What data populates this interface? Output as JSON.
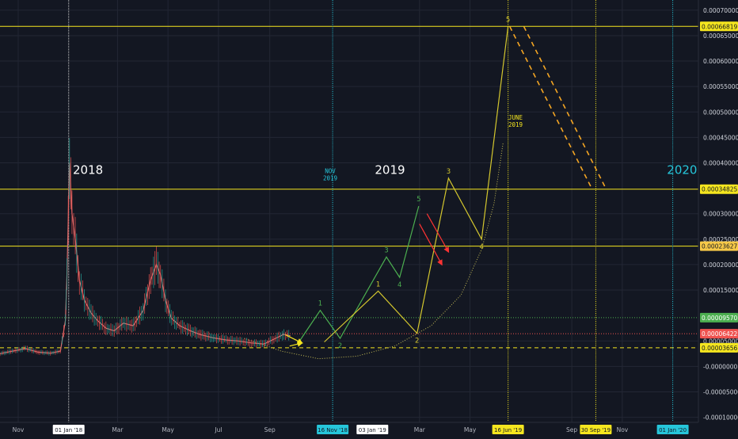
{
  "chart_data": {
    "type": "line",
    "x_range": [
      "2017-10-10",
      "2020-02-01"
    ],
    "y_range": [
      -0.00011,
      0.00072
    ],
    "price_ticks": [
      "0.00070000",
      "0.00065000",
      "0.00060000",
      "0.00055000",
      "0.00050000",
      "0.00045000",
      "0.00040000",
      "0.00030000",
      "0.00025000",
      "0.00020000",
      "0.00015000",
      "0.00005000",
      "-0.0000000",
      "-0.00005000",
      "-0.00010000"
    ],
    "time_ticks": [
      {
        "label": "Nov",
        "date": "2017-11-01"
      },
      {
        "label": "Mar",
        "date": "2018-03-01"
      },
      {
        "label": "May",
        "date": "2018-05-01"
      },
      {
        "label": "Jul",
        "date": "2018-07-01"
      },
      {
        "label": "Sep",
        "date": "2018-09-01"
      },
      {
        "label": "Mar",
        "date": "2019-03-01"
      },
      {
        "label": "May",
        "date": "2019-05-01"
      },
      {
        "label": "Sep",
        "date": "2019-09-01"
      },
      {
        "label": "Nov",
        "date": "2019-11-01"
      }
    ],
    "date_badges": [
      {
        "label": "01 Jan '18",
        "date": "2018-01-01",
        "color": "#ffffff",
        "line_color": "#cccccc"
      },
      {
        "label": "16 Nov '18",
        "date": "2018-11-16",
        "color": "#26c6da",
        "line_color": "#26c6da"
      },
      {
        "label": "03 Jan '19",
        "date": "2019-01-03",
        "color": "#ffffff",
        "line_color": null
      },
      {
        "label": "16 Jun '19",
        "date": "2019-06-16",
        "color": "#f5e61f",
        "line_color": "#f5e61f"
      },
      {
        "label": "30 Sep '19",
        "date": "2019-09-30",
        "color": "#f5e61f",
        "line_color": "#f5e61f"
      },
      {
        "label": "01 Jan '20",
        "date": "2020-01-01",
        "color": "#26c6da",
        "line_color": "#26c6da"
      }
    ],
    "price_levels": [
      {
        "label": "0.00066819",
        "value": 0.00066819,
        "color": "#f5e61f",
        "style": "solid"
      },
      {
        "label": "0.00034825",
        "value": 0.00034825,
        "color": "#f5e61f",
        "style": "solid"
      },
      {
        "label": "0.00023627",
        "value": 0.00023627,
        "color": "#f5e61f",
        "style": "solid",
        "badge_color": "#f7c948"
      },
      {
        "label": "0.00009570",
        "value": 9.57e-05,
        "color": "#4caf50",
        "style": "dotted",
        "badge_color": "#4caf50"
      },
      {
        "label": "0.00006422",
        "value": 6.422e-05,
        "color": "#ef5350",
        "style": "dotted",
        "badge_color": "#ef5350"
      },
      {
        "label": "0.00003656",
        "value": 3.656e-05,
        "color": "#f5e61f",
        "style": "dashed"
      }
    ],
    "year_labels": [
      {
        "text": "2018",
        "date": "2018-01-06",
        "value": 0.000378,
        "color": "#ffffff"
      },
      {
        "text": "2019",
        "date": "2019-01-06",
        "value": 0.000378,
        "color": "#ffffff"
      },
      {
        "text": "2020",
        "date": "2019-12-25",
        "value": 0.000378,
        "color": "#26c6da"
      }
    ],
    "notes": [
      {
        "lines": [
          "NOV",
          "2019"
        ],
        "date": "2018-11-13",
        "value": 0.00038,
        "color": "#26c6da"
      },
      {
        "lines": [
          "JUNE",
          "2019"
        ],
        "date": "2019-06-25",
        "value": 0.000485,
        "color": "#f5e61f"
      }
    ],
    "price_series": {
      "dates": [
        "2017-10-10",
        "2017-10-25",
        "2017-11-10",
        "2017-11-25",
        "2017-12-10",
        "2017-12-22",
        "2017-12-28",
        "2017-12-30",
        "2018-01-02",
        "2018-01-05",
        "2018-01-09",
        "2018-01-14",
        "2018-01-20",
        "2018-01-28",
        "2018-02-05",
        "2018-02-15",
        "2018-02-25",
        "2018-03-08",
        "2018-03-20",
        "2018-04-01",
        "2018-04-10",
        "2018-04-17",
        "2018-04-22",
        "2018-04-28",
        "2018-05-05",
        "2018-05-15",
        "2018-05-28",
        "2018-06-10",
        "2018-06-25",
        "2018-07-10",
        "2018-07-25",
        "2018-08-10",
        "2018-08-25",
        "2018-09-08",
        "2018-09-18",
        "2018-09-26"
      ],
      "values": [
        2.5e-05,
        3e-05,
        3.5e-05,
        2.8e-05,
        2.6e-05,
        3e-05,
        9e-05,
        0.00018,
        0.0004,
        0.0003,
        0.00025,
        0.00017,
        0.00013,
        0.000105,
        9e-05,
        7.5e-05,
        7e-05,
        8.5e-05,
        8e-05,
        0.00011,
        0.00017,
        0.0002,
        0.00018,
        0.00013,
        9.5e-05,
        8e-05,
        7e-05,
        6.2e-05,
        5.6e-05,
        5.2e-05,
        5e-05,
        4.6e-05,
        4.4e-05,
        5.5e-05,
        6.3e-05,
        6e-05
      ],
      "color": "#d66f6f"
    },
    "arrows": [
      {
        "color": "#f5e61f",
        "from": {
          "date": "2018-09-20",
          "value": 6.2e-05
        },
        "to": {
          "date": "2018-10-10",
          "value": 4.6e-05
        }
      },
      {
        "color": "#f5e61f",
        "from": {
          "date": "2018-09-25",
          "value": 4e-05
        },
        "to": {
          "date": "2018-10-10",
          "value": 4.6e-05
        }
      },
      {
        "color": "#ff3333",
        "from": {
          "date": "2019-03-10",
          "value": 0.0003
        },
        "to": {
          "date": "2019-04-05",
          "value": 0.000225
        }
      },
      {
        "color": "#ff3333",
        "from": {
          "date": "2019-03-01",
          "value": 0.00028
        },
        "to": {
          "date": "2019-03-28",
          "value": 0.0002
        }
      }
    ],
    "waves": [
      {
        "name": "",
        "color": "#4caf50",
        "dates": [
          "2018-10-05",
          "2018-11-01",
          "2018-11-25",
          "2019-01-20",
          "2019-02-05",
          "2019-02-28"
        ],
        "values": [
          4.5e-05,
          0.00011,
          5.5e-05,
          0.000215,
          0.000175,
          0.000315
        ],
        "labels": [
          "",
          "1",
          "2",
          "3",
          "4",
          "5"
        ]
      },
      {
        "name": "",
        "color": "#d4c72e",
        "dates": [
          "2018-11-06",
          "2019-01-10",
          "2019-02-26",
          "2019-04-05",
          "2019-05-15",
          "2019-06-16"
        ],
        "values": [
          4.8e-05,
          0.000148,
          6.5e-05,
          0.00037,
          0.00025,
          0.000668
        ],
        "labels": [
          "",
          "1",
          "2",
          "3",
          "4",
          "5"
        ]
      }
    ],
    "projection_lines": [
      {
        "color": "#f5a623",
        "from": {
          "date": "2019-06-18",
          "value": 0.000668
        },
        "to": {
          "date": "2019-09-25",
          "value": 0.00035
        }
      },
      {
        "color": "#f5a623",
        "from": {
          "date": "2019-07-05",
          "value": 0.000668
        },
        "to": {
          "date": "2019-10-12",
          "value": 0.00035
        }
      }
    ],
    "curve": {
      "color": "#c6bd55",
      "dates": [
        "2018-08-01",
        "2018-09-15",
        "2018-10-30",
        "2018-12-15",
        "2019-01-30",
        "2019-03-15",
        "2019-04-20",
        "2019-05-15",
        "2019-05-30",
        "2019-06-10"
      ],
      "values": [
        5.5e-05,
        3e-05,
        1.5e-05,
        2e-05,
        4e-05,
        8e-05,
        0.00014,
        0.00023,
        0.00032,
        0.00044
      ]
    }
  }
}
